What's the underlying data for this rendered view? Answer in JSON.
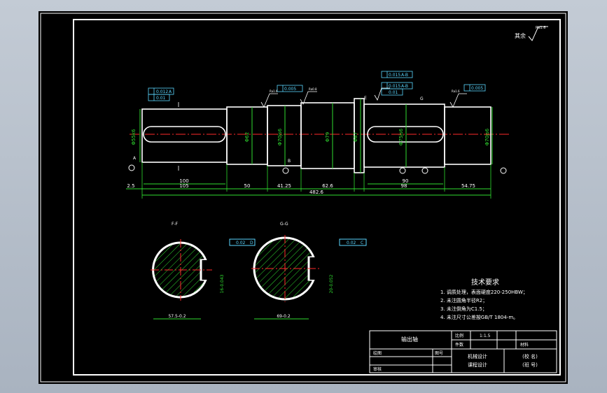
{
  "drawing": {
    "roughness_note": "其余",
    "roughness_value": "Ra1.6",
    "tech_req": {
      "title": "技术要求",
      "items": [
        "1. 调质处理，表面硬度220-250HBW；",
        "2. 未注圆角半径R2；",
        "3. 未注倒角为C1.5；",
        "4. 未注尺寸公差按GB/T 1804-m。"
      ]
    },
    "title_block": {
      "part_name": "输出轴",
      "scale_label": "比例",
      "scale_value": "1:1.5",
      "qty_label": "件数",
      "material_label": "材料",
      "drawn_label": "绘图",
      "checked_label": "审核",
      "drawing_no_label": "图号",
      "course_line1": "机械设计",
      "course_line2": "课程设计",
      "school_line1": "(校 名)",
      "school_line2": "(班 号)"
    },
    "section_labels": [
      "F-F",
      "G-G"
    ],
    "dimensions": {
      "bottom_row": [
        "2.5",
        "105",
        "50",
        "41.25",
        "62.6",
        "98",
        "54.75"
      ],
      "top_row": [
        "100",
        "90"
      ],
      "total": "482.6",
      "diameters": [
        "Φ55k6",
        "Φ62",
        "Φ70js6",
        "Φ79",
        "Φ87",
        "Φ75js6",
        "Φ70js6"
      ],
      "section_f_width": "57.5-0.2",
      "section_f_key": "16-0.043",
      "section_g_width": "69-0.2",
      "section_g_key": "20-0.052"
    },
    "gdt": {
      "frame_a1": "0.012",
      "frame_a1_ref": "A",
      "frame_a2": "0.01",
      "frame_b1": "0.005",
      "frame_mid1": "0.015",
      "frame_mid1_ref": "A-B",
      "frame_mid2": "0.015",
      "frame_mid2_ref": "A-B",
      "frame_mid3": "0.01",
      "frame_right": "0.005",
      "sec_f": "0.02",
      "sec_f_ref": "D",
      "sec_g": "0.02",
      "sec_g_ref": "C"
    },
    "datum_labels": [
      "A",
      "B",
      "C",
      "D",
      "E",
      "F",
      "G"
    ],
    "roughness_marks": [
      "Ra1.6",
      "Ra0.8",
      "Ra0.8",
      "Ra3.2",
      "Ra1.6",
      "Ra3.2",
      "Ra6.3"
    ]
  }
}
